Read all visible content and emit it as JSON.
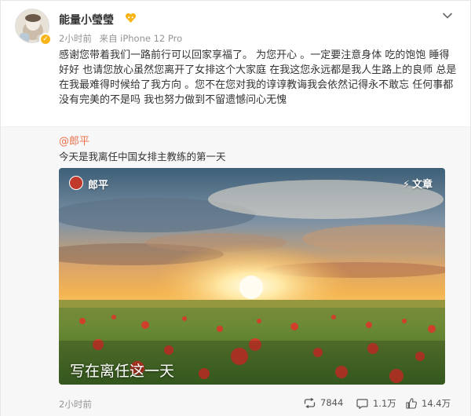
{
  "post": {
    "username": "能量小瑩瑩",
    "meta": {
      "time": "2小时前",
      "source": "来自 iPhone 12 Pro"
    },
    "content": "感谢您带着我们一路前行可以回家享福了。 为您开心 。一定要注意身体 吃的饱饱 睡得好好 也请您放心虽然您离开了女排这个大家庭 在我这您永远都是我人生路上的良师 总是在我最难得时候给了我方向 。您不在您对我的谆谆教诲我会依然记得永不敢忘 任何事都没有完美的不是吗 我也努力做到不留遗憾问心无愧"
  },
  "repost": {
    "author": "@郎平",
    "text": "今天是我离任中国女排主教练的第一天",
    "card": {
      "author": "郎平",
      "type_label": "文章",
      "title": "写在离任这一天"
    }
  },
  "footer": {
    "time": "2小时前",
    "repost_count": "7844",
    "comment_count": "1.1万",
    "like_count": "14.4万"
  },
  "colors": {
    "author_link": "#eb7350",
    "muted_text": "#939393",
    "repost_bg": "#f7f7f7",
    "vip_badge": "#f8b419"
  },
  "icons": {
    "vip": "vip-heart-icon",
    "chevron": "chevron-down-icon",
    "repost": "repost-icon",
    "comment": "comment-icon",
    "like": "like-icon",
    "article": "lightning-icon"
  }
}
